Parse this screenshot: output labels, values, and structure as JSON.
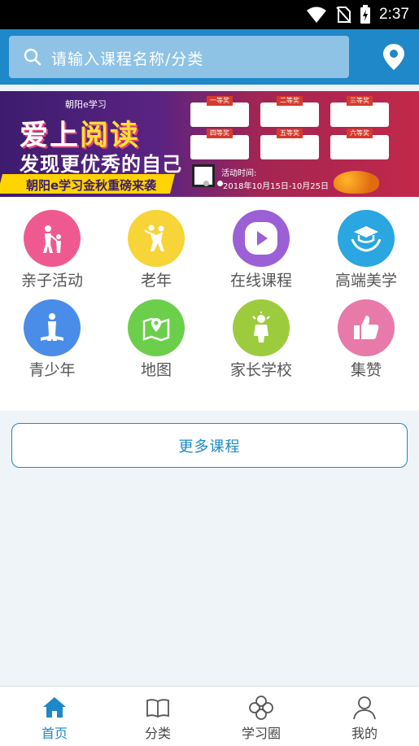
{
  "status_bar": {
    "time": "2:37"
  },
  "search": {
    "placeholder": "请输入课程名称/分类"
  },
  "banner": {
    "brand": "朝阳e学习",
    "headline_part1": "爱上",
    "headline_part2": "阅读",
    "headline2": "发现更优秀的自己",
    "ribbon": "朝阳e学习金秋重磅来袭",
    "event_label": "活动时间:",
    "event_date": "2018年10月15日-10月25日",
    "prizes": [
      "一等奖",
      "二等奖",
      "三等奖",
      "四等奖",
      "五等奖",
      "六等奖"
    ]
  },
  "menu": {
    "items": [
      {
        "label": "亲子活动",
        "icon": "parent-child-icon",
        "color": "#ee5a8f"
      },
      {
        "label": "老年",
        "icon": "dancing-couple-icon",
        "color": "#f7d437"
      },
      {
        "label": "在线课程",
        "icon": "play-video-icon",
        "color": "#9b5fd6"
      },
      {
        "label": "高端美学",
        "icon": "graduation-hands-icon",
        "color": "#2aa6e0"
      },
      {
        "label": "青少年",
        "icon": "teen-reading-icon",
        "color": "#4a8de8"
      },
      {
        "label": "地图",
        "icon": "map-pin-icon",
        "color": "#6ccf4b"
      },
      {
        "label": "家长学校",
        "icon": "parent-school-icon",
        "color": "#9ccc3d"
      },
      {
        "label": "集赞",
        "icon": "thumbs-up-icon",
        "color": "#e77aa8"
      }
    ]
  },
  "more_button": {
    "label": "更多课程"
  },
  "bottom_nav": {
    "items": [
      {
        "label": "首页",
        "icon": "home-icon",
        "active": true
      },
      {
        "label": "分类",
        "icon": "book-icon",
        "active": false
      },
      {
        "label": "学习圈",
        "icon": "clover-icon",
        "active": false
      },
      {
        "label": "我的",
        "icon": "user-icon",
        "active": false
      }
    ]
  },
  "colors": {
    "primary": "#1e88c8",
    "search_bg": "#8ec3e6",
    "page_bg": "#eef4f8"
  }
}
